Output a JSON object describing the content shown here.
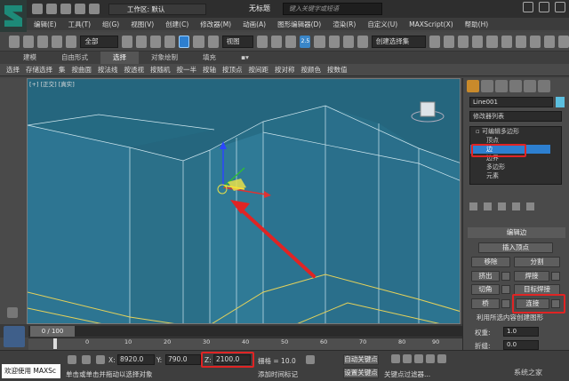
{
  "titlebar": {
    "workspace": "工作区: 默认",
    "doc_title": "无标题",
    "search_placeholder": "键入关键字或短语"
  },
  "menus": [
    "编辑(E)",
    "工具(T)",
    "组(G)",
    "视图(V)",
    "创建(C)",
    "修改器(M)",
    "动画(A)",
    "图形编辑器(D)",
    "渲染(R)",
    "自定义(U)",
    "MAXScript(X)",
    "帮助(H)"
  ],
  "toolbar": {
    "selection_filter": "全部",
    "ref_coord": "视图",
    "named_selection": "创建选择集",
    "snap_label": "2.5"
  },
  "ribbon": {
    "tabs": [
      "建模",
      "自由形式",
      "选择",
      "对象绘制",
      "填充"
    ],
    "active_tab": "选择",
    "tools": [
      "选择",
      "存储选择",
      "集",
      "按曲面",
      "按法线",
      "按透视",
      "按随机",
      "按一半",
      "按轴",
      "按顶点",
      "按间距",
      "按对称",
      "按颜色",
      "按数值"
    ]
  },
  "viewport": {
    "label": "[+] [正交] [真实]",
    "bg_color": "#25667e"
  },
  "command_panel": {
    "object_name": "Line001",
    "modifier_list": "修改器列表",
    "stack": {
      "root": "可编辑多边形",
      "items": [
        "顶点",
        "边",
        "边界",
        "多边形",
        "元素"
      ],
      "selected": "边"
    },
    "rollout_title": "编辑边",
    "insert_vertex": "插入顶点",
    "remove": "移除",
    "split": "分割",
    "extrude": "挤出",
    "weld": "焊接",
    "chamfer": "切角",
    "target_weld": "目标焊接",
    "bridge": "桥",
    "connect": "连接",
    "create_shape_text": "利用所选内容创建图形",
    "weight_label": "权重:",
    "weight_value": "1.0",
    "crease_label": "折缝:",
    "crease_value": "0.0"
  },
  "timeline": {
    "slider": "0 / 100",
    "ticks": [
      "0",
      "10",
      "20",
      "30",
      "40",
      "50",
      "60",
      "70",
      "80",
      "90",
      "100"
    ]
  },
  "statusbar": {
    "welcome": "欢迎使用 MAXSc",
    "message": "单击或单击并拖动以选择对象",
    "x_label": "X:",
    "x_value": "8920.0",
    "y_label": "Y:",
    "y_value": "790.0",
    "z_label": "Z:",
    "z_value": "2100.0",
    "grid": "栅格 = 10.0",
    "add_time_tag": "添加时间标记",
    "auto_key": "自动关键点",
    "set_key": "设置关键点",
    "key_filters": "关键点过滤器..."
  },
  "watermark": "系统之家",
  "colors": {
    "highlight_red": "#e02424",
    "selection_blue": "#2d7fd0",
    "accent_orange": "#c98a2b"
  }
}
